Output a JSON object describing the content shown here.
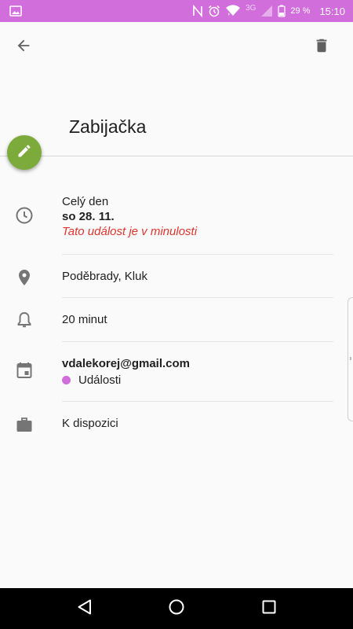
{
  "status_bar": {
    "network": "3G",
    "battery": "29 %",
    "time": "15:10",
    "background_color": "#d26ddc",
    "icons": [
      "image-icon",
      "nfc-icon",
      "alarm-icon",
      "wifi-icon",
      "signal-icon",
      "battery-icon"
    ]
  },
  "header": {
    "back_icon": "arrow-back-icon",
    "delete_icon": "trash-icon",
    "title": "Zabijačka"
  },
  "fab": {
    "icon": "pencil-icon",
    "color": "#7cab3c"
  },
  "details": {
    "time": {
      "icon": "clock-icon",
      "all_day": "Celý den",
      "date": "so 28. 11.",
      "past_notice": "Tato událost je v minulosti",
      "past_color": "#e0342f"
    },
    "location": {
      "icon": "location-pin-icon",
      "text": "Poděbrady, Kluk"
    },
    "reminder": {
      "icon": "bell-icon",
      "text": "20 minut"
    },
    "calendar": {
      "icon": "calendar-icon",
      "account": "vdalekorej@gmail.com",
      "name": "Události",
      "color": "#d26ddc"
    },
    "availability": {
      "icon": "briefcase-icon",
      "text": "K dispozici"
    }
  },
  "navbar": {
    "icons": [
      "back-triangle-icon",
      "home-circle-icon",
      "recents-square-icon"
    ]
  }
}
